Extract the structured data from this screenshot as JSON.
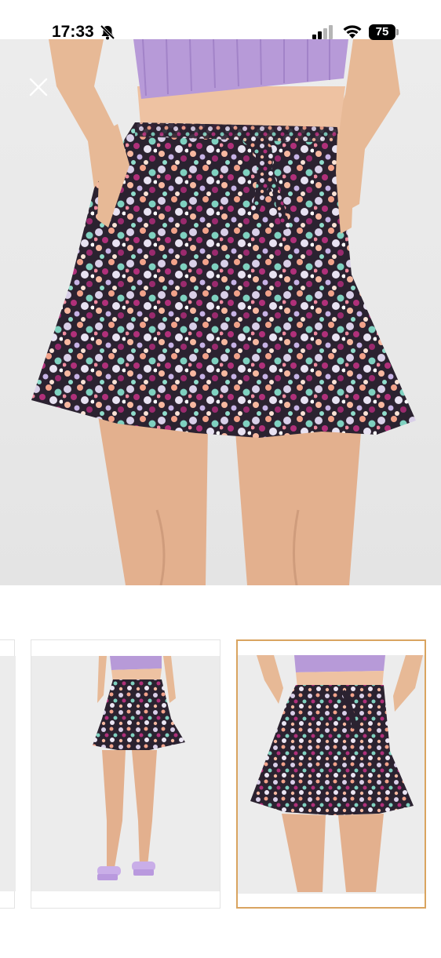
{
  "status_bar": {
    "time": "17:33",
    "battery": "75",
    "icons": [
      "bell-slash-icon",
      "signal-icon",
      "wifi-icon",
      "battery-icon"
    ]
  },
  "viewer": {
    "close_icon": "close-icon",
    "thumbnails": [
      {
        "selected": false
      },
      {
        "selected": false
      },
      {
        "selected": true
      }
    ],
    "colors": {
      "selected_border": "#d9a460",
      "top": "#b79ad8",
      "skin": "#e9bc9a",
      "background": "#ececec"
    }
  }
}
